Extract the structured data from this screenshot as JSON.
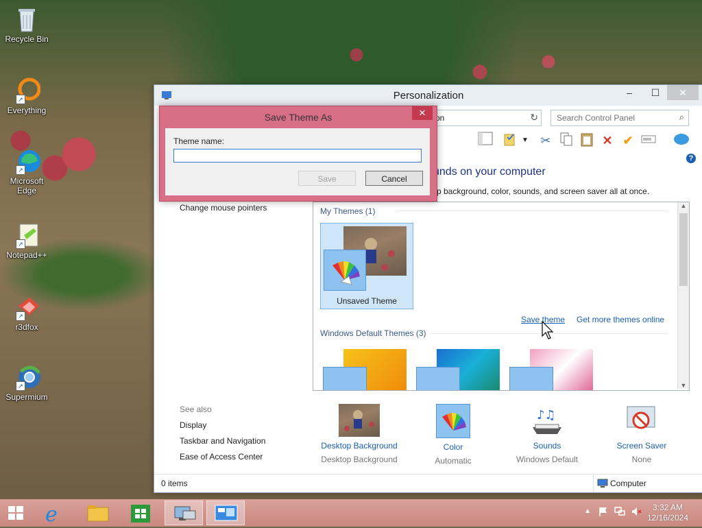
{
  "desktop": {
    "icons": [
      {
        "label": "Recycle Bin",
        "icon": "recycle-bin-icon"
      },
      {
        "label": "Everything",
        "icon": "everything-icon"
      },
      {
        "label": "Microsoft Edge",
        "icon": "edge-icon"
      },
      {
        "label": "Notepad++",
        "icon": "notepad-plus-plus-icon"
      },
      {
        "label": "r3dfox",
        "icon": "r3dfox-icon"
      },
      {
        "label": "Supermium",
        "icon": "supermium-icon"
      }
    ]
  },
  "window": {
    "title": "Personalization",
    "address_visible": "on",
    "search_placeholder": "Search Control Panel",
    "heading": "unds on your computer",
    "subheading": "p background, color, sounds, and screen saver all at once.",
    "left_links": [
      "Change mouse pointers"
    ],
    "see_also": {
      "label": "See also",
      "links": [
        "Display",
        "Taskbar and Navigation",
        "Ease of Access Center"
      ]
    },
    "my_themes_label": "My Themes (1)",
    "unsaved_theme_label": "Unsaved Theme",
    "save_theme_link": "Save theme",
    "get_more_link": "Get more themes online",
    "default_themes_label": "Windows Default Themes (3)",
    "bottom_items": [
      {
        "label": "Desktop Background",
        "sub": "Desktop Background"
      },
      {
        "label": "Color",
        "sub": "Automatic"
      },
      {
        "label": "Sounds",
        "sub": "Windows Default"
      },
      {
        "label": "Screen Saver",
        "sub": "None"
      }
    ],
    "status_left": "0 items",
    "status_right": "Computer"
  },
  "dialog": {
    "title": "Save Theme As",
    "field_label": "Theme name:",
    "field_value": "",
    "save_label": "Save",
    "cancel_label": "Cancel"
  },
  "taskbar": {
    "time": "3:32 AM",
    "date": "12/16/2024"
  }
}
